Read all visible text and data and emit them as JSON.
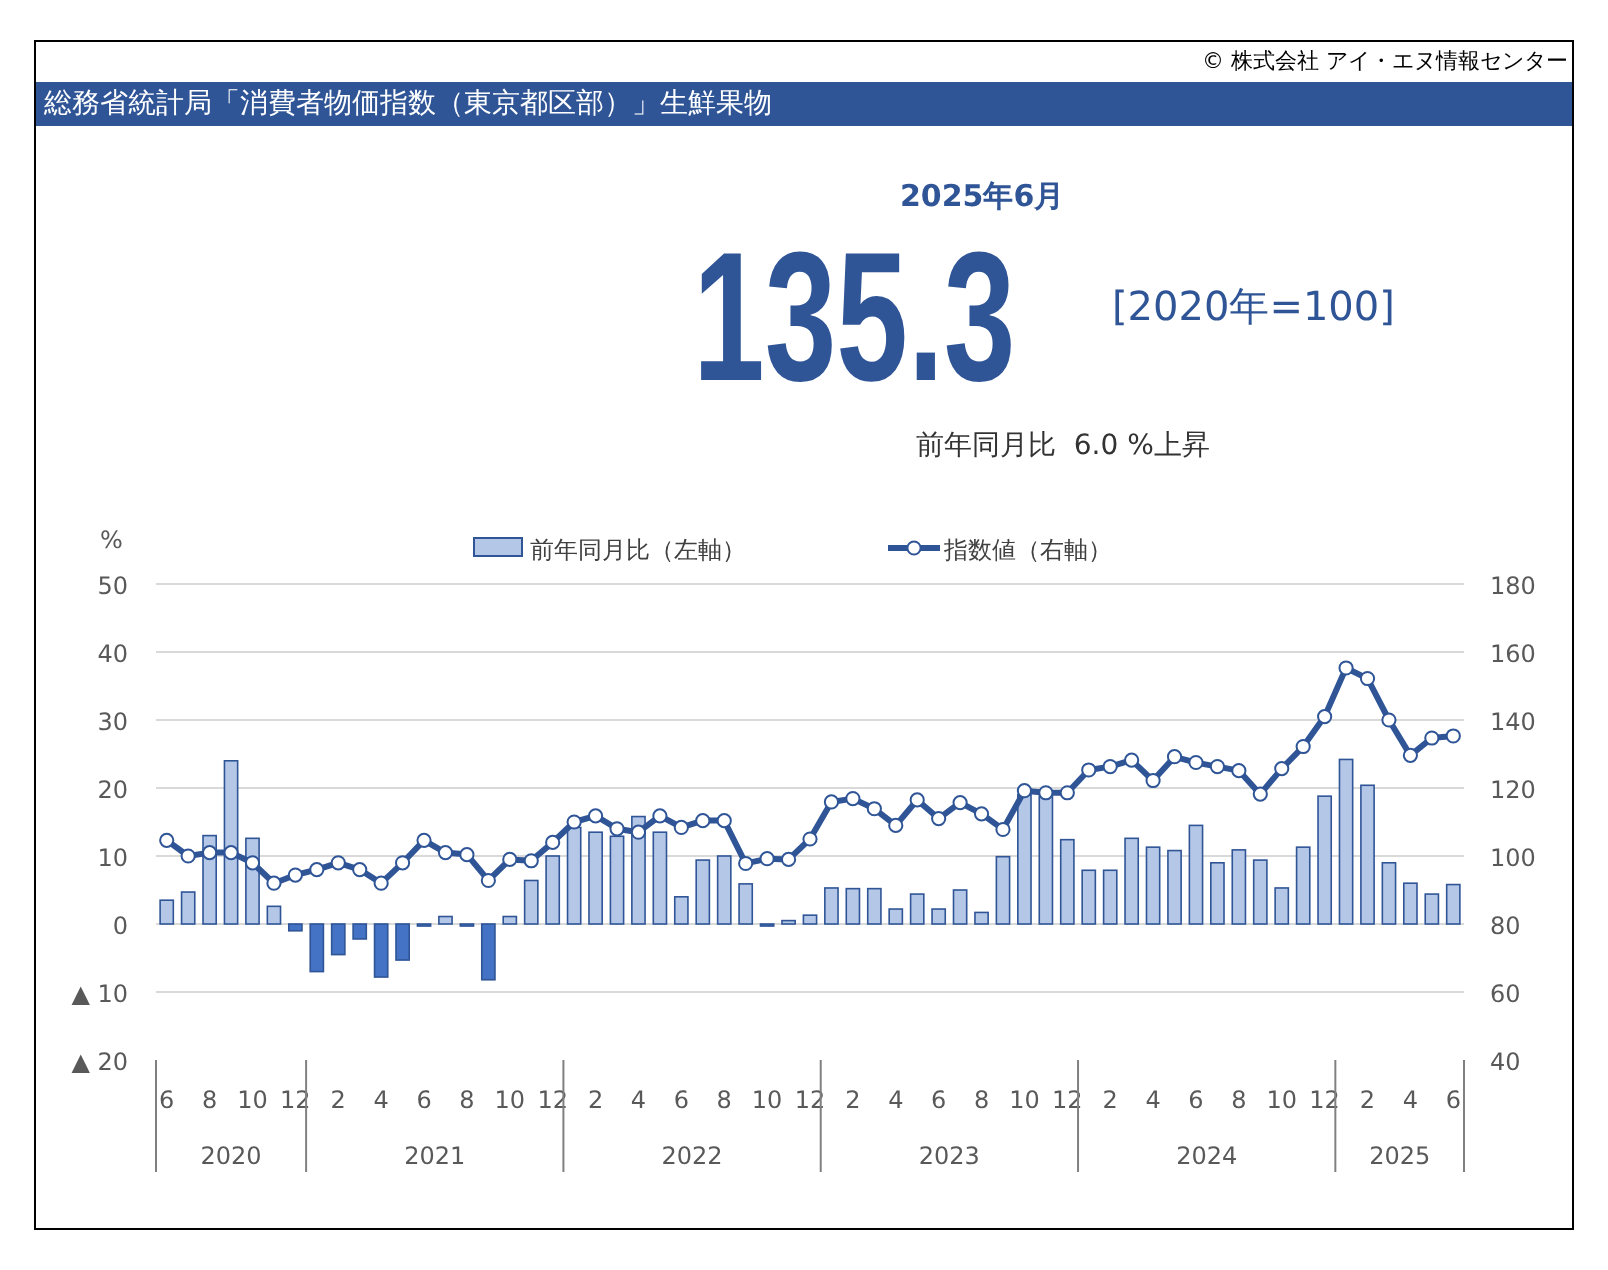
{
  "copyright": "© 株式会社 アイ・エヌ情報センター",
  "title": "総務省統計局「消費者物価指数（東京都区部）」生鮮果物",
  "period": "2025年6月",
  "index_value": "135.3",
  "base_note": "[2020年=100]",
  "change_note": "前年同月比  6.0 %上昇",
  "change_chart": {
    "chart_data": {
      "type": "bar",
      "ylabel": "%",
      "grid": true,
      "stacked": true,
      "categories": [
        "6",
        null,
        "8",
        null,
        "10",
        null,
        "12",
        null,
        "2",
        null,
        "4",
        null,
        "6",
        null,
        "8",
        null,
        "10",
        null,
        "12",
        null,
        "2",
        null,
        "4",
        null,
        "6",
        null,
        "8",
        null,
        "10",
        null,
        "12",
        null,
        "2",
        null,
        "4",
        null,
        "6",
        null,
        "8",
        null,
        "10",
        null,
        "12",
        null,
        "2",
        null,
        "4",
        null,
        "6",
        null,
        "8",
        null,
        "10",
        null,
        "12",
        null,
        "2",
        null,
        "4",
        null,
        "6"
      ],
      "annotations": [
        "2020",
        "2021",
        "2022",
        "2023",
        "2024",
        "2025"
      ],
      "ylim": [
        -20,
        50
      ],
      "yticks": [
        50,
        40,
        30,
        20,
        10,
        0,
        {
          "value": -10,
          "label": "▲ 10"
        },
        {
          "value": -20,
          "label": "▲ 20"
        }
      ],
      "series": [
        {
          "name": "前年同月比（左軸）",
          "color": "#b4c7e7",
          "values": [
            3.5,
            4.7,
            13,
            24,
            12.6,
            2.6,
            null,
            null,
            null,
            null,
            null,
            null,
            null,
            1.1,
            null,
            null,
            1.1,
            6.4,
            10,
            14.2,
            13.5,
            12.9,
            15.8,
            13.5,
            4,
            9.4,
            10,
            5.9,
            null,
            0.5,
            1.3,
            5.3,
            5.2,
            5.2,
            2.2,
            4.4,
            2.2,
            5,
            1.7,
            9.9,
            19,
            18.8,
            12.4,
            7.9,
            7.9,
            12.6,
            11.3,
            10.8,
            14.5,
            9,
            10.9,
            9.4,
            5.3,
            11.3,
            18.8,
            24.2,
            20.4,
            9,
            6,
            4.4,
            5.8
          ]
        },
        {
          "color": "#4472c4",
          "values": [
            null,
            null,
            null,
            null,
            null,
            null,
            -1,
            -7,
            -4.5,
            -2.2,
            -7.8,
            -5.3,
            -0.3,
            null,
            -0.3,
            -8.2,
            null,
            null,
            null,
            null,
            null,
            null,
            null,
            null,
            null,
            null,
            null,
            null,
            -0.3,
            null,
            null,
            null,
            null,
            null,
            null,
            null,
            null,
            null,
            null,
            null,
            null,
            null,
            null,
            null,
            null,
            null,
            null,
            null,
            null,
            null,
            null,
            null,
            null,
            null,
            null,
            null,
            null,
            null,
            null,
            null,
            null
          ]
        }
      ]
    }
  },
  "index_chart": {
    "chart_data": {
      "type": "line",
      "ylim": [
        40,
        180
      ],
      "yticks": [
        180,
        160,
        140,
        120,
        100,
        80,
        60,
        40
      ],
      "series": [
        {
          "name": "指数値（右軸）",
          "color": "#2f5597",
          "marker": "o",
          "values": [
            104.6,
            100,
            101,
            101,
            98,
            92,
            94.4,
            96,
            98,
            96,
            92,
            98,
            104.6,
            101,
            100.4,
            92.8,
            99,
            98.6,
            104,
            110,
            111.8,
            108,
            107,
            111.8,
            108.4,
            110.4,
            110.4,
            97.8,
            99.2,
            99,
            105,
            115.9,
            116.9,
            113.9,
            109,
            116.5,
            111,
            115.7,
            112.4,
            107.8,
            119.2,
            118.6,
            118.6,
            125.3,
            126.3,
            128.2,
            122.2,
            129.2,
            127.5,
            126.3,
            125.1,
            118.2,
            125.7,
            132.2,
            141,
            155.3,
            152.2,
            140,
            129.6,
            134.7,
            135.3
          ]
        }
      ]
    }
  }
}
